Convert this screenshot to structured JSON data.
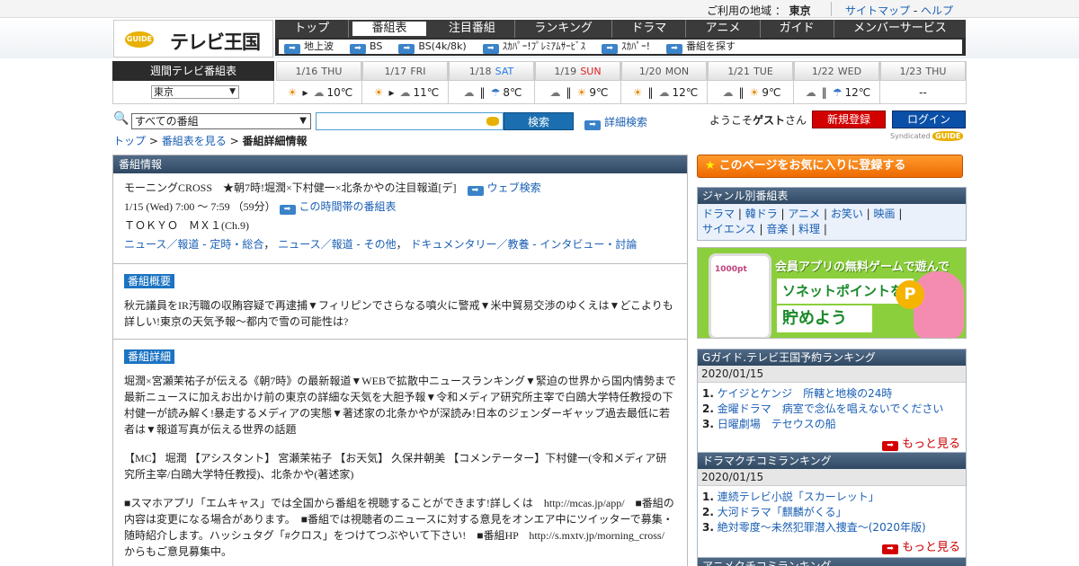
{
  "topbar": {
    "area_label": "ご利用の地域 ：",
    "area_value": "東京",
    "sitemap": "サイトマップ",
    "dash": "-",
    "help": "ヘルプ"
  },
  "logo": {
    "g_text": "GUIDE",
    "title": "テレビ王国"
  },
  "nav": [
    "トップ",
    "番組表",
    "注目番組",
    "ランキング",
    "ドラマ",
    "アニメ",
    "ガイド",
    "メンバーサービス"
  ],
  "subnav": [
    "地上波",
    "BS",
    "BS(4k/8k)",
    "ｽｶﾊﾟｰ!ﾌﾟﾚﾐｱﾑｻｰﾋﾞｽ",
    "ｽｶﾊﾟｰ!",
    "番組を探す"
  ],
  "weekly": {
    "label": "週間テレビ番組表",
    "region": "東京"
  },
  "days": [
    {
      "date": "1/16",
      "dow": "THU",
      "dow_color": "#555555",
      "weather": [
        {
          "i": "sun",
          "s": "☀"
        },
        {
          "i": "to",
          "s": "▸"
        },
        {
          "i": "cld",
          "s": "☁"
        }
      ],
      "temp": "10℃"
    },
    {
      "date": "1/17",
      "dow": "FRI",
      "dow_color": "#555555",
      "weather": [
        {
          "i": "sun",
          "s": "☀"
        },
        {
          "i": "to",
          "s": "▸"
        },
        {
          "i": "cld",
          "s": "☁"
        }
      ],
      "temp": "11℃"
    },
    {
      "date": "1/18",
      "dow": "SAT",
      "dow_color": "#2a7ae2",
      "weather": [
        {
          "i": "cld",
          "s": "☁"
        },
        {
          "i": "or",
          "s": "‖"
        },
        {
          "i": "umb",
          "s": "☂"
        }
      ],
      "temp": "8℃"
    },
    {
      "date": "1/19",
      "dow": "SUN",
      "dow_color": "#e02020",
      "weather": [
        {
          "i": "cld",
          "s": "☁"
        },
        {
          "i": "or",
          "s": "‖"
        },
        {
          "i": "sun",
          "s": "☀"
        }
      ],
      "temp": "9℃"
    },
    {
      "date": "1/20",
      "dow": "MON",
      "dow_color": "#555555",
      "weather": [
        {
          "i": "sun",
          "s": "☀"
        },
        {
          "i": "or",
          "s": "‖"
        },
        {
          "i": "cld",
          "s": "☁"
        }
      ],
      "temp": "12℃"
    },
    {
      "date": "1/21",
      "dow": "TUE",
      "dow_color": "#555555",
      "weather": [
        {
          "i": "cld",
          "s": "☁"
        },
        {
          "i": "or",
          "s": "‖"
        },
        {
          "i": "sun",
          "s": "☀"
        }
      ],
      "temp": "9℃"
    },
    {
      "date": "1/22",
      "dow": "WED",
      "dow_color": "#555555",
      "weather": [
        {
          "i": "cld",
          "s": "☁"
        },
        {
          "i": "or",
          "s": "‖"
        },
        {
          "i": "umb",
          "s": "☂"
        }
      ],
      "temp": "12℃"
    },
    {
      "date": "1/23",
      "dow": "THU",
      "dow_color": "#555555",
      "weather": [],
      "temp": "--"
    }
  ],
  "search": {
    "genre": "すべての番組",
    "keyword": "",
    "button": "検索",
    "advanced": "詳細検索"
  },
  "user": {
    "welcome_pre": "ようこそ",
    "name": "ゲスト",
    "welcome_post": "さん",
    "register": "新規登録",
    "login": "ログイン"
  },
  "breadcrumb": {
    "top": "トップ",
    "sep": ">",
    "guide": "番組表を見る",
    "current": "番組詳細情報"
  },
  "syndicated": {
    "label": "Syndicated",
    "g": "GUIDE"
  },
  "program": {
    "panel_title": "番組情報",
    "title": "モーニングCROSS　★朝7時!堀潤×下村健一×北条かやの注目報道[デ]",
    "web_search": "ウェブ検索",
    "time": "1/15 (Wed) 7:00 ～ 7:59 （59分）",
    "timeslot": "この時間帯の番組表",
    "channel": "ＴＯＫＹＯ　ＭＸ１(Ch.9)",
    "genres": [
      {
        "link": "ニュース／報道 - 定時・総合",
        "sep": "，"
      },
      {
        "link": "ニュース／報道 - その他",
        "sep": "，"
      },
      {
        "link": "ドキュメンタリー／教養 - インタビュー・討論",
        "sep": ""
      }
    ],
    "summary_label": "番組概要",
    "summary": "秋元議員をIR汚職の収賄容疑で再逮捕▼フィリピンでさらなる噴火に警戒▼米中貿易交渉のゆくえは▼どこよりも詳しい!東京の天気予報～都内で雪の可能性は?",
    "detail_label": "番組詳細",
    "detail": [
      "堀潤×宮瀬茉祐子が伝える《朝7時》の最新報道▼WEBで拡散中ニュースランキング▼緊迫の世界から国内情勢まで最新ニュースに加えお出かけ前の東京の詳細な天気を大胆予報▼令和メディア研究所主宰で白鴎大学特任教授の下村健一が読み解く!暴走するメディアの実態▼著述家の北条かやが深読み!日本のジェンダーギャップ過去最低に若者は▼報道写真が伝える世界の話題",
      "【MC】 堀潤 【アシスタント】 宮瀬茉祐子 【お天気】 久保井朝美 【コメンテーター】下村健一(令和メディア研究所主宰/白鴎大学特任教授)、北条かや(著述家)",
      "■スマホアプリ「エムキャス」では全国から番組を視聴することができます!詳しくは　http://mcas.jp/app/　■番組の内容は変更になる場合があります。　■番組では視聴者のニュースに対する意見をオンエア中にツイッターで募集・随時紹介します。ハッシュタグ「#クロス」をつけてつぶやいて下さい!　■番組HP　http://s.mxtv.jp/morning_cross/　からもご意見募集中。"
    ]
  },
  "favorite": {
    "label": "このページをお気に入りに登録する"
  },
  "genre_box": {
    "title": "ジャンル別番組表",
    "items": [
      "ドラマ",
      "韓ドラ",
      "アニメ",
      "お笑い",
      "映画",
      "サイエンス",
      "音楽",
      "料理"
    ]
  },
  "banner": {
    "pt": "1000pt",
    "line1": "会員アプリの無料ゲームで遊んで",
    "line2": "ソネットポイントを",
    "line3": "貯めよう",
    "coin": "P"
  },
  "rank_reserve": {
    "title": "Gガイド.テレビ王国予約ランキング",
    "date": "2020/01/15",
    "items": [
      "ケイジとケンジ　所轄と地検の24時",
      "金曜ドラマ　病室で念仏を唱えないでください",
      "日曜劇場　テセウスの船"
    ],
    "more": "もっと見る"
  },
  "rank_drama": {
    "title": "ドラマクチコミランキング",
    "date": "2020/01/15",
    "items": [
      "連続テレビ小説「スカーレット」",
      "大河ドラマ「麒麟がくる」",
      "絶対零度～未然犯罪潜入捜査～(2020年版)"
    ],
    "more": "もっと見る"
  },
  "rank_anime": {
    "title": "アニメクチコミランキング"
  }
}
